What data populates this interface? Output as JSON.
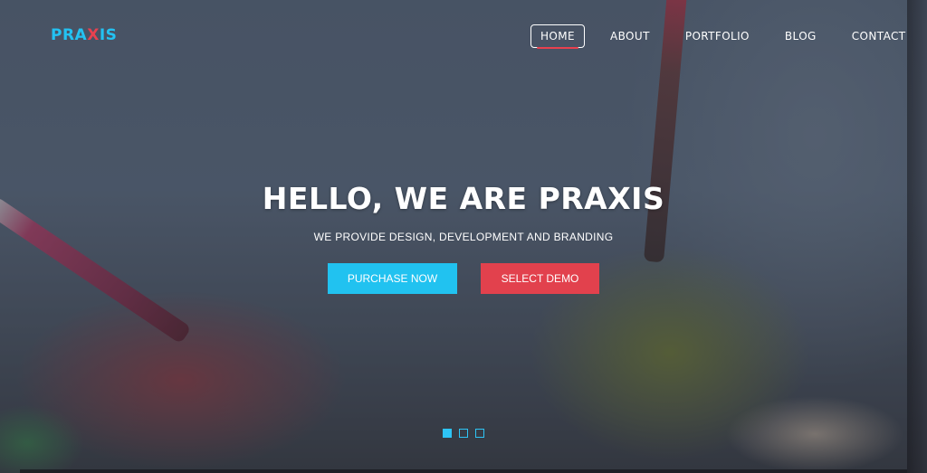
{
  "brand": {
    "logo_part_a": "PRA",
    "logo_part_b": "X",
    "logo_part_c": "IS",
    "primary_color": "#21c2f0",
    "accent_color": "#e2414d"
  },
  "nav": {
    "items": [
      {
        "label": "HOME",
        "active": true
      },
      {
        "label": "ABOUT",
        "active": false
      },
      {
        "label": "PORTFOLIO",
        "active": false
      },
      {
        "label": "BLOG",
        "active": false
      },
      {
        "label": "CONTACT",
        "active": false
      }
    ]
  },
  "hero": {
    "title": "HELLO, WE ARE PRAXIS",
    "subtitle": "WE PROVIDE DESIGN, DEVELOPMENT AND BRANDING",
    "primary_cta": "PURCHASE NOW",
    "secondary_cta": "SELECT DEMO"
  },
  "slider": {
    "count": 3,
    "active_index": 0
  }
}
